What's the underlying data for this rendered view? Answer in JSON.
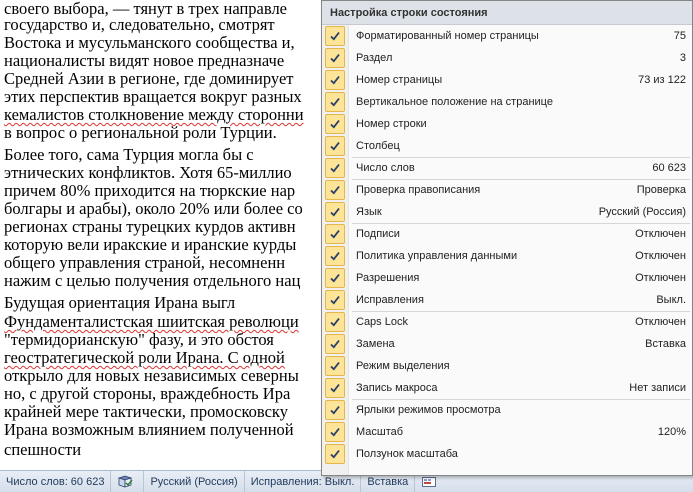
{
  "document": {
    "lines": [
      {
        "text": "своего выбора, — тянут в трех направле",
        "sq": false
      },
      {
        "text": "государство и, следовательно, смотрят",
        "sq": false
      },
      {
        "text": "Востока и мусульманского сообщества и,",
        "sq": false
      },
      {
        "text": "националисты видят новое предназначе",
        "sq": false
      },
      {
        "text": "Средней Азии в регионе, где доминирует",
        "sq": false
      },
      {
        "text": "этих перспектив вращается вокруг разных",
        "sq": false
      },
      {
        "text": "кемалистов столкновение между сторонни",
        "sq": true
      },
      {
        "text": "в вопрос о региональной роли Турции.",
        "sq": false
      },
      {
        "text": "    Более того, сама Турция могла бы с",
        "sq": false
      },
      {
        "text": "этнических конфликтов. Хотя 65-миллио",
        "sq": false
      },
      {
        "text": "причем 80% приходится на тюркские нар",
        "sq": false
      },
      {
        "text": "болгары и арабы), около 20% или более со",
        "sq": false
      },
      {
        "text": "регионах страны турецких курдов активн",
        "sq": false
      },
      {
        "text": "которую вели иракские и иранские курды",
        "sq": false
      },
      {
        "text": "общего управления страной, несомненн",
        "sq": false
      },
      {
        "text": "нажим с целью получения отдельного нац",
        "sq": false
      },
      {
        "text": "    Будущая ориентация Ирана выгл",
        "sq": false
      },
      {
        "text": "Фундаменталистская шиитская революци",
        "sq": true
      },
      {
        "text": "\"термидорианскую\" фазу, и это обстоя",
        "sq": false
      },
      {
        "text": "геостратегической роли Ирана. С одной",
        "sq": true
      },
      {
        "text": "открыло для новых независимых северны",
        "sq": false
      },
      {
        "text": "но, с другой стороны, враждебность Ира",
        "sq": false
      },
      {
        "text": "крайней мере тактически, промосковску",
        "sq": false
      },
      {
        "text": "Ирана возможным влиянием полученной",
        "sq": false
      },
      {
        "text": "спешности",
        "sq": false
      }
    ]
  },
  "statusbar": {
    "word_count": "Число слов: 60 623",
    "language": "Русский (Россия)",
    "track_changes": "Исправления: Выкл.",
    "insert_mode": "Вставка"
  },
  "menu": {
    "title": "Настройка строки состояния",
    "items": [
      {
        "label": "Форматированный номер страницы",
        "value": "75",
        "sep": false
      },
      {
        "label": "Раздел",
        "value": "3",
        "sep": false
      },
      {
        "label": "Номер страницы",
        "value": "73 из 122",
        "sep": false
      },
      {
        "label": "Вертикальное положение на странице",
        "value": "",
        "sep": false
      },
      {
        "label": "Номер строки",
        "value": "",
        "sep": false
      },
      {
        "label": "Столбец",
        "value": "",
        "sep": true
      },
      {
        "label": "Число слов",
        "value": "60 623",
        "sep": true
      },
      {
        "label": "Проверка правописания",
        "value": "Проверка",
        "sep": false
      },
      {
        "label": "Язык",
        "value": "Русский (Россия)",
        "sep": true
      },
      {
        "label": "Подписи",
        "value": "Отключен",
        "sep": false
      },
      {
        "label": "Политика управления данными",
        "value": "Отключен",
        "sep": false
      },
      {
        "label": "Разрешения",
        "value": "Отключен",
        "sep": false
      },
      {
        "label": "Исправления",
        "value": "Выкл.",
        "sep": true
      },
      {
        "label": "Caps Lock",
        "value": "Отключен",
        "sep": false
      },
      {
        "label": "Замена",
        "value": "Вставка",
        "sep": false
      },
      {
        "label": "Режим выделения",
        "value": "",
        "sep": false
      },
      {
        "label": "Запись макроса",
        "value": "Нет записи",
        "sep": true
      },
      {
        "label": "Ярлыки режимов просмотра",
        "value": "",
        "sep": false
      },
      {
        "label": "Масштаб",
        "value": "120%",
        "sep": false
      },
      {
        "label": "Ползунок масштаба",
        "value": "",
        "sep": false
      }
    ]
  },
  "colors": {
    "check_bg": "#fde496",
    "check_border": "#e3b74a",
    "check_mark": "#2a3f6a"
  }
}
